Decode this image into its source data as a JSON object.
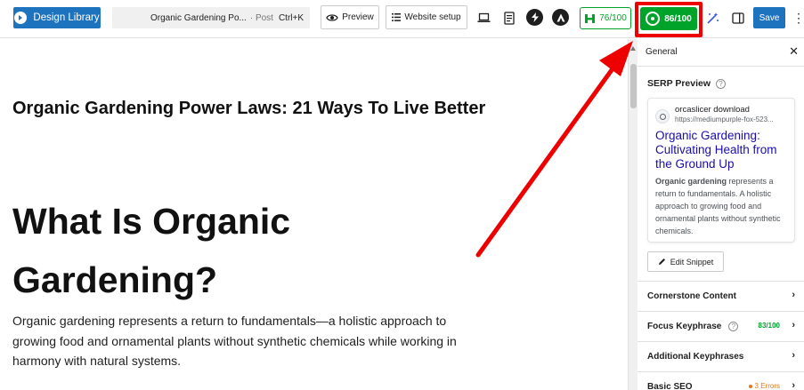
{
  "topbar": {
    "design_library": "Design Library",
    "doc_title": "Organic Gardening Po...",
    "doc_type": "· Post",
    "shortcut": "Ctrl+K",
    "preview": "Preview",
    "website_setup": "Website setup",
    "seo_score": "76/100",
    "readability_score": "86/100",
    "save": "Save"
  },
  "content": {
    "post_title": "Organic Gardening Power Laws: 21 Ways To Live Better",
    "heading": "What Is Organic Gardening?",
    "paragraph": "Organic gardening represents a return to fundamentals—a holistic approach to growing food and ornamental plants without synthetic chemicals while working in harmony with natural systems."
  },
  "sidebar": {
    "panel_label": "General",
    "serp_title": "SERP Preview",
    "site_name": "orcaslicer download",
    "site_url": "https://mediumpurple-fox-523...",
    "serp_link": "Organic Gardening: Cultivating Health from the Ground Up",
    "serp_desc_bold": "Organic gardening",
    "serp_desc_rest": " represents a return to fundamentals. A holistic approach to growing food and ornamental plants without synthetic chemicals.",
    "edit_snippet": "Edit Snippet",
    "cornerstone": "Cornerstone Content",
    "focus_keyphrase": "Focus Keyphrase",
    "focus_score": "83/100",
    "additional_keyphrases": "Additional Keyphrases",
    "basic_seo": "Basic SEO",
    "basic_seo_errors": "3 Errors"
  },
  "colors": {
    "primary_blue": "#1e73be",
    "score_green": "#00a32a",
    "annotation_red": "#ee0000",
    "serp_link": "#1a0dab",
    "error_orange": "#e3781a"
  }
}
